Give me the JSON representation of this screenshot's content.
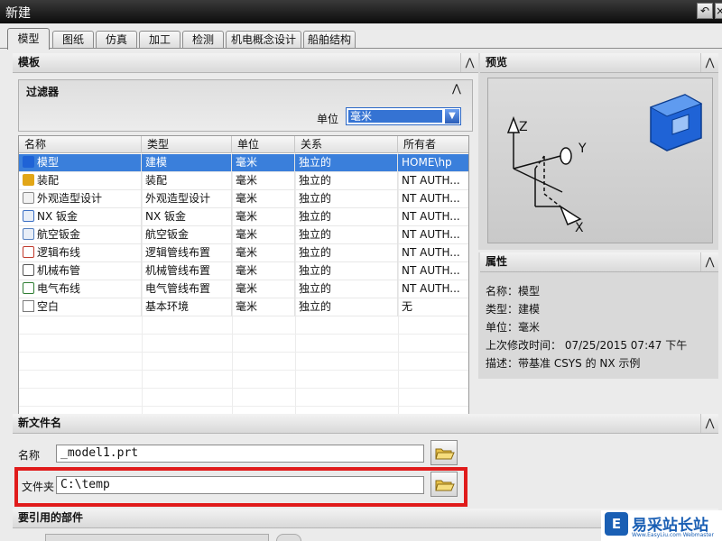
{
  "window": {
    "title": "新建"
  },
  "tabs": [
    "模型",
    "图纸",
    "仿真",
    "加工",
    "检测",
    "机电概念设计",
    "船舶结构"
  ],
  "template_section": {
    "title": "模板"
  },
  "filter": {
    "title": "过滤器",
    "unit_label": "单位",
    "unit_value": "毫米"
  },
  "table": {
    "headers": [
      "名称",
      "类型",
      "单位",
      "关系",
      "所有者"
    ],
    "rows": [
      {
        "name": "模型",
        "type": "建模",
        "unit": "毫米",
        "relation": "独立的",
        "owner": "HOME\\hp",
        "icon": "model-icon"
      },
      {
        "name": "装配",
        "type": "装配",
        "unit": "毫米",
        "relation": "独立的",
        "owner": "NT AUTH...",
        "icon": "assembly-icon"
      },
      {
        "name": "外观造型设计",
        "type": "外观造型设计",
        "unit": "毫米",
        "relation": "独立的",
        "owner": "NT AUTH...",
        "icon": "shape-studio-icon"
      },
      {
        "name": "NX 钣金",
        "type": "NX 钣金",
        "unit": "毫米",
        "relation": "独立的",
        "owner": "NT AUTH...",
        "icon": "sheet-metal-icon"
      },
      {
        "name": "航空钣金",
        "type": "航空钣金",
        "unit": "毫米",
        "relation": "独立的",
        "owner": "NT AUTH...",
        "icon": "aero-sheet-metal-icon"
      },
      {
        "name": "逻辑布线",
        "type": "逻辑管线布置",
        "unit": "毫米",
        "relation": "独立的",
        "owner": "NT AUTH...",
        "icon": "logical-routing-icon"
      },
      {
        "name": "机械布管",
        "type": "机械管线布置",
        "unit": "毫米",
        "relation": "独立的",
        "owner": "NT AUTH...",
        "icon": "mechanical-routing-icon"
      },
      {
        "name": "电气布线",
        "type": "电气管线布置",
        "unit": "毫米",
        "relation": "独立的",
        "owner": "NT AUTH...",
        "icon": "electrical-routing-icon"
      },
      {
        "name": "空白",
        "type": "基本环境",
        "unit": "毫米",
        "relation": "独立的",
        "owner": "无",
        "icon": "blank-file-icon"
      }
    ]
  },
  "preview": {
    "title": "预览",
    "axis_z": "Z",
    "axis_y": "Y",
    "axis_x": "X"
  },
  "properties": {
    "title": "属性",
    "lines": [
      "名称：模型",
      "类型：建模",
      "单位：毫米",
      "上次修改时间：  07/25/2015 07:47 下午",
      "描述：带基准 CSYS 的 NX 示例"
    ]
  },
  "new_file": {
    "title": "新文件名",
    "name_label": "名称",
    "name_value": "_model1.prt",
    "folder_label": "文件夹",
    "folder_value": "C:\\temp"
  },
  "references": {
    "title": "要引用的部件"
  },
  "watermark": {
    "brand": "易采站长站",
    "letter": "E",
    "sub": "Www.EasyLiu.com   Webmaster"
  },
  "colors": {
    "selection": "#3a7fdb",
    "highlight_box": "#e01b1b",
    "title_bar": "#1a1a1a",
    "model_icon": "#1f63d6"
  }
}
